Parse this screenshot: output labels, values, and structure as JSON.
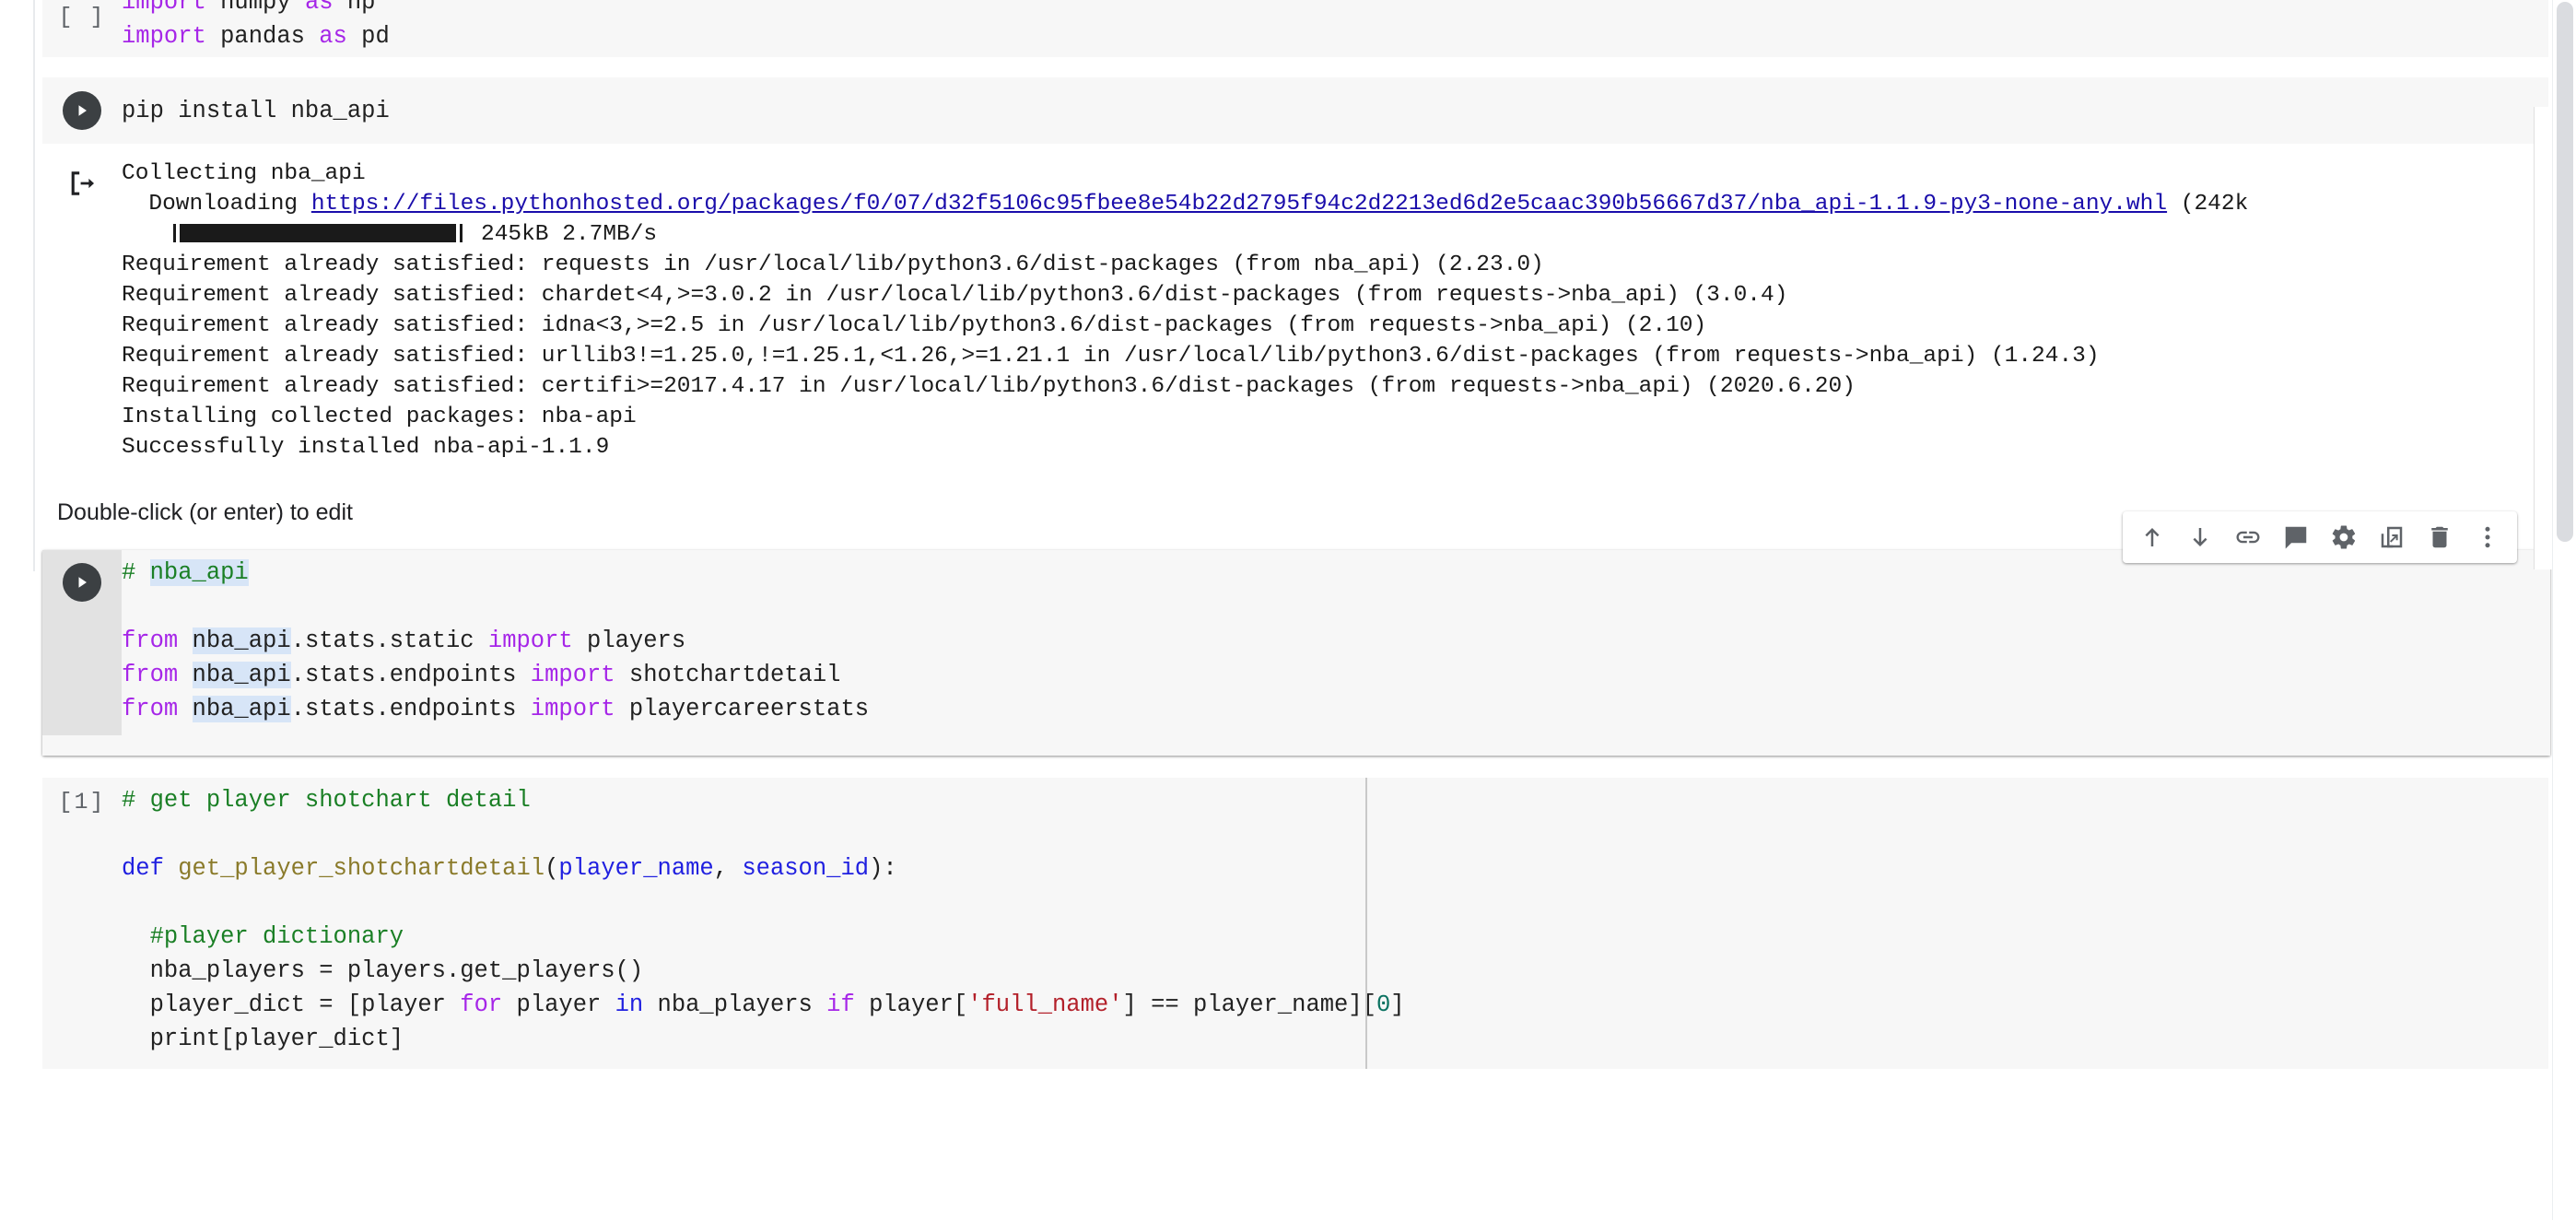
{
  "cells": {
    "imports": {
      "prompt": "[ ]",
      "lines": [
        "import numpy as np",
        "import pandas as pd"
      ],
      "kw1": "import",
      "rest1": " numpy ",
      "as1": "as",
      "np": " np",
      "kw2": "import",
      "rest2": " pandas ",
      "as2": "as",
      "pd": " pd"
    },
    "pip": {
      "run_icon": "run-cell-icon",
      "code": "pip install nba_api"
    },
    "output": {
      "icon": "output-stream-icon",
      "line_collecting": "Collecting nba_api",
      "line_downloading_prefix": "  Downloading ",
      "download_url": "https://files.pythonhosted.org/packages/f0/07/d32f5106c95fbee8e54b22d2795f94c2d2213ed6d2e5caac390b56667d37/nba_api-1.1.9-py3-none-any.whl",
      "download_size_suffix": " (242k",
      "progress_stats": "245kB 2.7MB/s",
      "line_requests": "Requirement already satisfied: requests in /usr/local/lib/python3.6/dist-packages (from nba_api) (2.23.0)",
      "line_chardet": "Requirement already satisfied: chardet<4,>=3.0.2 in /usr/local/lib/python3.6/dist-packages (from requests->nba_api) (3.0.4)",
      "line_idna": "Requirement already satisfied: idna<3,>=2.5 in /usr/local/lib/python3.6/dist-packages (from requests->nba_api) (2.10)",
      "line_urllib3": "Requirement already satisfied: urllib3!=1.25.0,!=1.25.1,<1.26,>=1.21.1 in /usr/local/lib/python3.6/dist-packages (from requests->nba_api) (1.24.3)",
      "line_certifi": "Requirement already satisfied: certifi>=2017.4.17 in /usr/local/lib/python3.6/dist-packages (from requests->nba_api) (2020.6.20)",
      "line_installing": "Installing collected packages: nba-api",
      "line_success": "Successfully installed nba-api-1.1.9"
    },
    "markdown": {
      "text": "Double-click (or enter) to edit"
    },
    "nbaapi": {
      "run_icon": "run-cell-icon",
      "comment": "# ",
      "comment_hl": "nba_api",
      "l2_from": "from ",
      "l2_mod_hl": "nba_api",
      "l2_mod_rest": ".stats.static ",
      "l2_import": "import",
      "l2_target": " players",
      "l3_from": "from ",
      "l3_mod_hl": "nba_api",
      "l3_mod_rest": ".stats.endpoints ",
      "l3_import": "import",
      "l3_target": " shotchartdetail",
      "l4_from": "from ",
      "l4_mod_hl": "nba_api",
      "l4_mod_rest": ".stats.endpoints ",
      "l4_import": "import",
      "l4_target": " playercareerstats",
      "toolbar": [
        {
          "name": "move-cell-up-button",
          "label": "Move cell up"
        },
        {
          "name": "move-cell-down-button",
          "label": "Move cell down"
        },
        {
          "name": "link-to-cell-button",
          "label": "Link to cell"
        },
        {
          "name": "add-comment-button",
          "label": "Add a comment"
        },
        {
          "name": "cell-settings-button",
          "label": "Settings"
        },
        {
          "name": "mirror-cell-in-tab-button",
          "label": "Mirror cell in tab"
        },
        {
          "name": "delete-cell-button",
          "label": "Delete cell"
        },
        {
          "name": "more-cell-actions-button",
          "label": "More cell actions"
        }
      ]
    },
    "shotchart": {
      "prompt": "[1]",
      "comment": "# get player shotchart detail",
      "def_kw": "def ",
      "def_name": "get_player_shotchartdetail",
      "def_sig_open": "(",
      "def_arg1": "player_name",
      "def_comma": ", ",
      "def_arg2": "season_id",
      "def_sig_close": "):",
      "inner_comment": "  #player dictionary",
      "line_players": "  nba_players = players.get_players()",
      "ld_pre": "  player_dict = [player ",
      "ld_for": "for",
      "ld_mid1": " player ",
      "ld_in": "in",
      "ld_mid2": " nba_players ",
      "ld_if": "if",
      "ld_mid3": " player[",
      "ld_str": "'full_name'",
      "ld_mid4": "] == player_name][",
      "ld_num": "0",
      "ld_end": "]",
      "line_print": "  print[player_dict]"
    }
  },
  "colors": {
    "keyword_purple": "#a626e8",
    "keyword_blue": "#2020e0",
    "comment_green": "#1a7f25",
    "string_red": "#b3202a",
    "number_teal": "#0b7261",
    "function_olive": "#8a7a2a",
    "link_blue": "#1a0dab",
    "cell_bg": "#f7f7f7",
    "gutter_selected": "#e2e2e2"
  }
}
